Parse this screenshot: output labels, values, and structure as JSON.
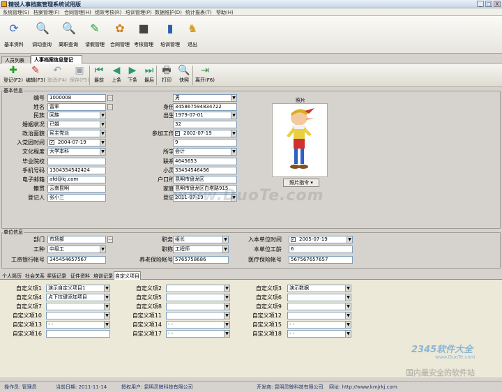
{
  "title": "精锐人事档案管理系统试用版",
  "window_buttons": {
    "minimize": "_",
    "maximize": "□",
    "close": "X"
  },
  "menu": [
    "系统管理(S)",
    "档案管理(F)",
    "合同管理(H)",
    "绩效考核(R)",
    "培训管理(P)",
    "数据维护(D)",
    "统计报表(T)",
    "帮助(H)"
  ],
  "toolbar": [
    {
      "label": "基本资料",
      "icon": "basic-info-icon",
      "glyph": "⟳",
      "color": "#3b6fc4"
    },
    {
      "label": "调动查询",
      "icon": "magnifier-icon",
      "glyph": "🔍",
      "color": "#3a78c8"
    },
    {
      "label": "离职查询",
      "icon": "magnifier-icon",
      "glyph": "🔍",
      "color": "#c83a3a"
    },
    {
      "label": "请假管理",
      "icon": "checklist-icon",
      "glyph": "✎",
      "color": "#2a9a3a"
    },
    {
      "label": "合同管理",
      "icon": "contract-icon",
      "glyph": "✿",
      "color": "#d08020"
    },
    {
      "label": "考核管理",
      "icon": "assessment-icon",
      "glyph": "■",
      "color": "#444"
    },
    {
      "label": "培训管理",
      "icon": "training-icon",
      "glyph": "▮",
      "color": "#2a5fb0"
    },
    {
      "label": "退出",
      "icon": "exit-icon",
      "glyph": "♞",
      "color": "#d8a020"
    }
  ],
  "tabs": [
    "人员列表",
    "人事档案信息登记"
  ],
  "toolbar2": [
    {
      "label": "登记(F2)",
      "icon": "add-icon",
      "glyph": "✚",
      "color": "#20a020",
      "disabled": false
    },
    {
      "label": "编辑(F3)",
      "icon": "edit-icon",
      "glyph": "✎",
      "color": "#c03030",
      "disabled": false
    },
    {
      "label": "取消(F4)",
      "icon": "undo-icon",
      "glyph": "↶",
      "color": "#8aa0c0",
      "disabled": true
    },
    {
      "label": "保存(F5)",
      "icon": "save-icon",
      "glyph": "▣",
      "color": "#9aa0a8",
      "disabled": true
    },
    {
      "label": "最前",
      "icon": "first-icon",
      "glyph": "⏮",
      "color": "#2a9a6a",
      "disabled": false
    },
    {
      "label": "上条",
      "icon": "prev-icon",
      "glyph": "◀",
      "color": "#2a9a6a",
      "disabled": false
    },
    {
      "label": "下条",
      "icon": "next-icon",
      "glyph": "▶",
      "color": "#2a9a6a",
      "disabled": false
    },
    {
      "label": "最后",
      "icon": "last-icon",
      "glyph": "⏭",
      "color": "#2a9a6a",
      "disabled": false
    },
    {
      "label": "打印",
      "icon": "print-icon",
      "glyph": "🖶",
      "color": "#555",
      "disabled": false
    },
    {
      "label": "快照",
      "icon": "snapshot-icon",
      "glyph": "🔍",
      "color": "#3a78c8",
      "disabled": false
    },
    {
      "label": "离开(F6)",
      "icon": "leave-icon",
      "glyph": "⇥",
      "color": "#2a8a3a",
      "disabled": false
    }
  ],
  "basic": {
    "group_label": "基本信息",
    "fields": [
      {
        "label": "编号",
        "value": "1000008",
        "ctl": "ellipsis"
      },
      {
        "label": "姓名",
        "value": "雷军",
        "ctl": "ellipsis"
      },
      {
        "label": "民族",
        "value": "回族",
        "ctl": "dropdown"
      },
      {
        "label": "婚姻状况",
        "value": "已婚",
        "ctl": "dropdown"
      },
      {
        "label": "政治面貌",
        "value": "民主党派",
        "ctl": "dropdown"
      },
      {
        "label": "入党团时间",
        "value": "2004-07-19",
        "ctl": "date"
      },
      {
        "label": "文化程度",
        "value": "大学本科",
        "ctl": "dropdown"
      },
      {
        "label": "毕业院校",
        "value": "",
        "ctl": "text"
      },
      {
        "label": "手机号码",
        "value": "1304354542424",
        "ctl": "text"
      },
      {
        "label": "电子邮箱",
        "value": "afd@kj.com",
        "ctl": "text"
      },
      {
        "label": "籍贯",
        "value": "云南昆明",
        "ctl": "text"
      },
      {
        "label": "登记人",
        "value": "张小三",
        "ctl": "text"
      }
    ],
    "fields2": [
      {
        "label": "性别",
        "value": "男",
        "ctl": "dropdown"
      },
      {
        "label": "身份证号",
        "value": "345867594834722",
        "ctl": "text"
      },
      {
        "label": "出生日期",
        "value": "1979-07-01",
        "ctl": "dropdown"
      },
      {
        "label": "年龄",
        "value": "32",
        "ctl": "text"
      },
      {
        "label": "参加工作时间",
        "value": "2002-07-19",
        "ctl": "date"
      },
      {
        "label": "工龄",
        "value": "9",
        "ctl": "text"
      },
      {
        "label": "所学专业",
        "value": "会计",
        "ctl": "dropdown"
      },
      {
        "label": "联系电话",
        "value": "4645653",
        "ctl": "text"
      },
      {
        "label": "小灵通号",
        "value": "33454546456",
        "ctl": "text"
      },
      {
        "label": "户口所在地",
        "value": "昆明市盘龙区",
        "ctl": "text"
      },
      {
        "label": "家庭住址",
        "value": "昆明市盘龙区白塔路915",
        "ctl": "text"
      },
      {
        "label": "登记日期",
        "value": "2011-07-19",
        "ctl": "dropdown"
      }
    ],
    "photo_label": "照片",
    "photo_button": "照片指令 ▾"
  },
  "unit": {
    "group_label": "单位信息",
    "fields": [
      {
        "label": "部门",
        "value": "市场部",
        "ctl": "ellipsis"
      },
      {
        "label": "工种",
        "value": "中级工",
        "ctl": "dropdown"
      },
      {
        "label": "工资银行帐号",
        "value": "345454657567",
        "ctl": "text"
      },
      {
        "label": "职务",
        "value": "组长",
        "ctl": "dropdown"
      },
      {
        "label": "职称",
        "value": "工程师",
        "ctl": "dropdown"
      },
      {
        "label": "养老保险帐号",
        "value": "5765758686",
        "ctl": "text"
      },
      {
        "label": "入本单位时间",
        "value": "2005-07-19",
        "ctl": "date"
      },
      {
        "label": "本单位工龄",
        "value": "6",
        "ctl": "text"
      },
      {
        "label": "医疗保险帐号",
        "value": "567567657657",
        "ctl": "text"
      }
    ]
  },
  "subtabs": [
    "个人简历",
    "社会关系",
    "奖惩记录",
    "证件资料",
    "培训记录",
    "自定义项目"
  ],
  "custom": [
    {
      "label": "自定义项1",
      "value": "演示自定义项目1",
      "ctl": "dropdown"
    },
    {
      "label": "自定义项2",
      "value": "",
      "ctl": "dropdown"
    },
    {
      "label": "自定义项3",
      "value": "演示数据",
      "ctl": "dropdown"
    },
    {
      "label": "自定义项4",
      "value": "点下拉键添加项目",
      "ctl": "dropdown"
    },
    {
      "label": "自定义项5",
      "value": "",
      "ctl": "dropdown"
    },
    {
      "label": "自定义项6",
      "value": "",
      "ctl": "dropdown"
    },
    {
      "label": "自定义项7",
      "value": "",
      "ctl": "dropdown"
    },
    {
      "label": "自定义项8",
      "value": "",
      "ctl": "dropdown"
    },
    {
      "label": "自定义项9",
      "value": "",
      "ctl": "dropdown"
    },
    {
      "label": "自定义项10",
      "value": "",
      "ctl": "dropdown"
    },
    {
      "label": "自定义项11",
      "value": "",
      "ctl": "dropdown"
    },
    {
      "label": "自定义项12",
      "value": "",
      "ctl": "dropdown"
    },
    {
      "label": "自定义项13",
      "value": "-  -",
      "ctl": "dropdown"
    },
    {
      "label": "自定义项14",
      "value": "-  -",
      "ctl": "dropdown"
    },
    {
      "label": "自定义项15",
      "value": "-  -",
      "ctl": "dropdown"
    },
    {
      "label": "自定义项16",
      "value": "",
      "ctl": "text"
    },
    {
      "label": "自定义项17",
      "value": "-  -",
      "ctl": "dropdown"
    },
    {
      "label": "自定义项18",
      "value": "-  -",
      "ctl": "dropdown"
    }
  ],
  "status": [
    "操作员: 管理员",
    "当前日期: 2011-11-14",
    "授权用户: 昆明灵鲸科技有限公司",
    "开发商: 昆明灵鲸科技有限公司",
    "网址: http://www.kmjrkj.com"
  ],
  "watermarks": {
    "center": "www.DuoTe.com",
    "logo1": "2345软件大全",
    "logo2": "www.DuoTe.com",
    "logo3": "国内最安全的软件站"
  }
}
